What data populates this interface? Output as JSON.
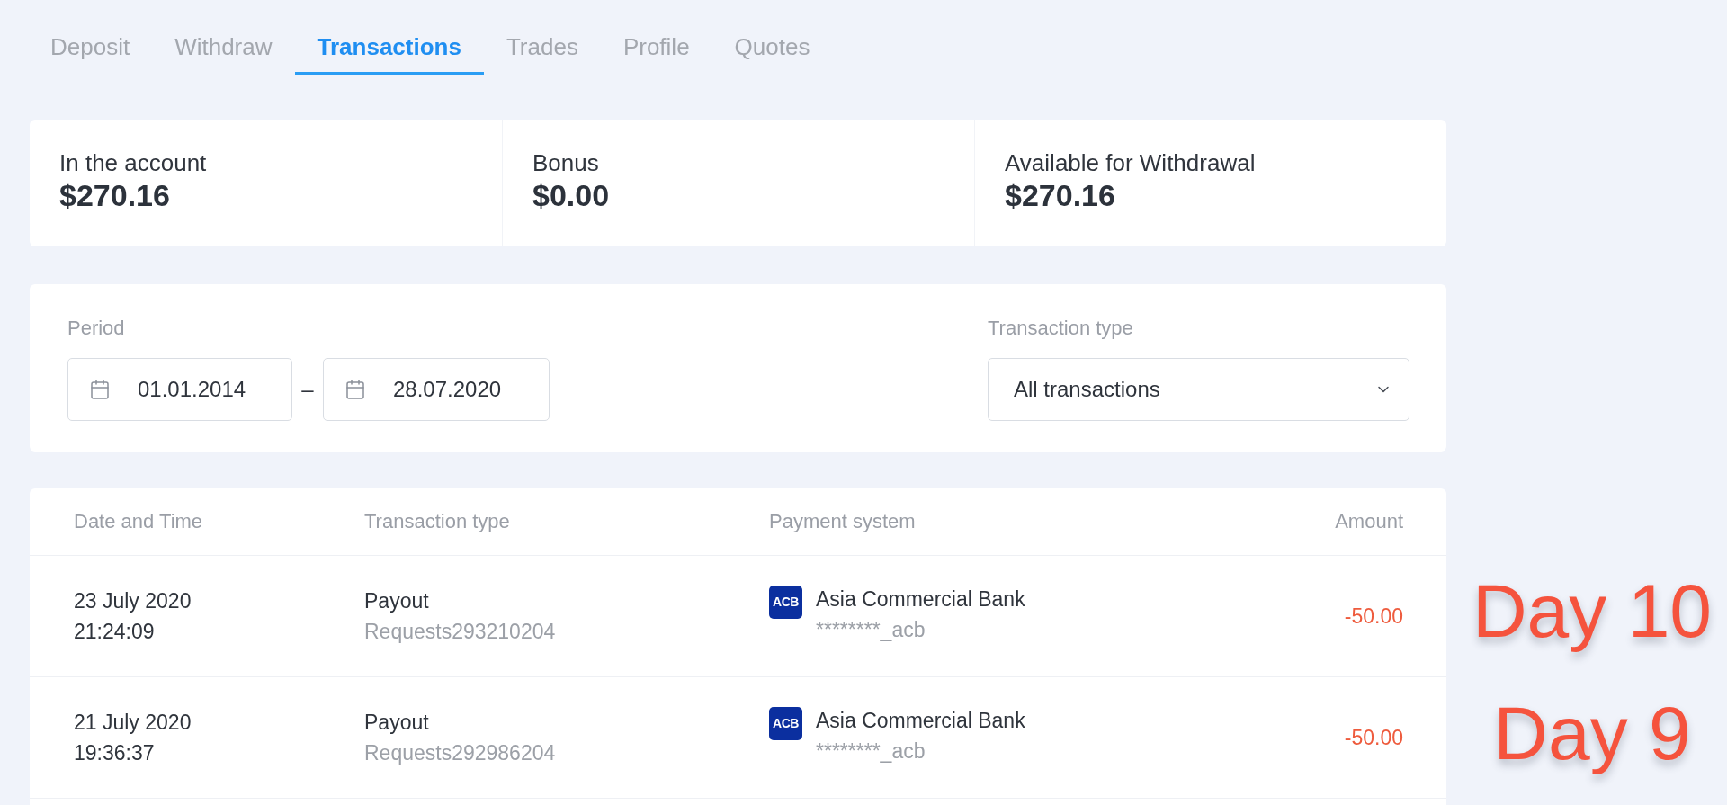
{
  "tabs": [
    {
      "label": "Deposit",
      "selected": false
    },
    {
      "label": "Withdraw",
      "selected": false
    },
    {
      "label": "Transactions",
      "selected": true
    },
    {
      "label": "Trades",
      "selected": false
    },
    {
      "label": "Profile",
      "selected": false
    },
    {
      "label": "Quotes",
      "selected": false
    }
  ],
  "balances": [
    {
      "label": "In the account",
      "value": "$270.16"
    },
    {
      "label": "Bonus",
      "value": "$0.00"
    },
    {
      "label": "Available for Withdrawal",
      "value": "$270.16"
    }
  ],
  "filters": {
    "period": {
      "label": "Period",
      "from": "01.01.2014",
      "separator": "–",
      "to": "28.07.2020"
    },
    "transaction_type": {
      "label": "Transaction type",
      "value": "All transactions"
    }
  },
  "table": {
    "columns": [
      "Date and Time",
      "Transaction type",
      "Payment system",
      "Amount"
    ],
    "rows": [
      {
        "date": "23 July 2020",
        "time": "21:24:09",
        "type": "Payout",
        "request": "Requests293210204",
        "payment_system": {
          "logo_text": "ACB",
          "name": "Asia Commercial Bank",
          "account": "********_acb"
        },
        "amount": "-50.00"
      },
      {
        "date": "21 July 2020",
        "time": "19:36:37",
        "type": "Payout",
        "request": "Requests292986204",
        "payment_system": {
          "logo_text": "ACB",
          "name": "Asia Commercial Bank",
          "account": "********_acb"
        },
        "amount": "-50.00"
      }
    ]
  },
  "overlay_captions": [
    "Day 10",
    "Day 9"
  ]
}
